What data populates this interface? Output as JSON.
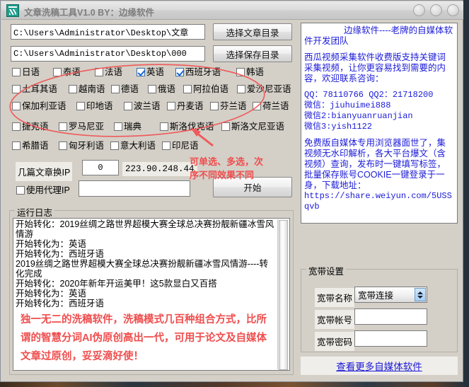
{
  "window": {
    "title": "文章洗稿工具V1.0 BY：边缘软件",
    "icon": "app-logo-icon",
    "buttons": [
      "minimize",
      "maximize",
      "close"
    ]
  },
  "paths": {
    "article_dir_value": "C:\\Users\\Administrator\\Desktop\\文章",
    "save_dir_value": "C:\\Users\\Administrator\\Desktop\\000",
    "article_dir_button": "选择文章目录",
    "save_dir_button": "选择保存目录"
  },
  "languages": {
    "rows": [
      [
        {
          "label": "日语",
          "checked": false
        },
        {
          "label": "泰语",
          "checked": false
        },
        {
          "label": "法语",
          "checked": false
        },
        {
          "label": "英语",
          "checked": true
        },
        {
          "label": "西班牙语",
          "checked": true
        },
        {
          "label": "韩语",
          "checked": false
        }
      ],
      [
        {
          "label": "土耳其语",
          "checked": false
        },
        {
          "label": "越南语",
          "checked": false
        },
        {
          "label": "德语",
          "checked": false
        },
        {
          "label": "俄语",
          "checked": false
        },
        {
          "label": "阿拉伯语",
          "checked": false
        },
        {
          "label": "爱沙尼亚语",
          "checked": false
        }
      ],
      [
        {
          "label": "保加利亚语",
          "checked": false
        },
        {
          "label": "印地语",
          "checked": false
        },
        {
          "label": "波兰语",
          "checked": false
        },
        {
          "label": "丹麦语",
          "checked": false
        },
        {
          "label": "芬兰语",
          "checked": false
        },
        {
          "label": "荷兰语",
          "checked": false
        }
      ],
      [
        {
          "label": "捷克语",
          "checked": false
        },
        {
          "label": "罗马尼亚",
          "checked": false
        },
        {
          "label": "瑞典",
          "checked": false
        },
        {
          "label": "斯洛伐克语",
          "checked": false
        },
        {
          "label": "斯洛文尼亚语",
          "checked": false
        }
      ],
      [
        {
          "label": "希腊语",
          "checked": false
        },
        {
          "label": "匈牙利语",
          "checked": false
        },
        {
          "label": "意大利语",
          "checked": false
        },
        {
          "label": "印尼语",
          "checked": false
        }
      ]
    ]
  },
  "controls": {
    "change_ip_label": "几篇文章换IP",
    "change_ip_value": "0",
    "current_ip": "223.90.248.44",
    "use_proxy_label": "使用代理IP",
    "use_proxy_checked": false,
    "proxy_value": "",
    "start_button": "开始"
  },
  "annotations": {
    "note_languages_line1": "可单选、多选，次",
    "note_languages_line2": "序不同效果不同",
    "red_color": "#ef4e4e"
  },
  "log": {
    "legend": "运行日志",
    "lines": [
      "开始转化：2019丝绸之路世界超模大赛全球总决赛扮靓新疆冰雪风情游",
      "开始转化为：英语",
      "开始转化为：西班牙语",
      "2019丝绸之路世界超模大赛全球总决赛扮靓新疆冰雪风情游----转化完成",
      "开始转化：2020年新年开运美甲！这5款显白又百搭",
      "开始转化为：英语",
      "开始转化为：西班牙语"
    ],
    "promo": "独一无二的洗稿软件，洗稿模式几百种组合方式，比所谓的智慧分词AI伪原创高出一代，可用于论文及自媒体文章过原创，妥妥滴好使！"
  },
  "info_panel": {
    "line_company": "边缘软件----老牌的自媒体软件开发团队",
    "line_product": "西瓜视频采集软件收费版支持关键词采集视频，让你更容易找到需要的内容，欢迎联系咨询：",
    "line_qq": "QQ：78110766 QQ2：21718200",
    "line_wechat1": "微信：jiuhuimei888",
    "line_wechat2": "微信2:bianyuanruanjian",
    "line_wechat3": "微信3:yish1122",
    "line_browser": "免费版自媒体专用浏览器面世了，集视频无水印解析，各大平台爆文（含视频）查询，发布时一键填写标签，批量保存账号COOKIE一键登录于一身，下载地址：",
    "line_url": "https://share.weiyun.com/5USSqvb"
  },
  "broadband": {
    "legend": "宽带设置",
    "name_label": "宽带名称",
    "name_value": "宽带连接",
    "account_label": "宽带帐号",
    "account_value": "",
    "password_label": "宽带密码",
    "password_value": "",
    "more_link": "查看更多自媒体软件"
  }
}
